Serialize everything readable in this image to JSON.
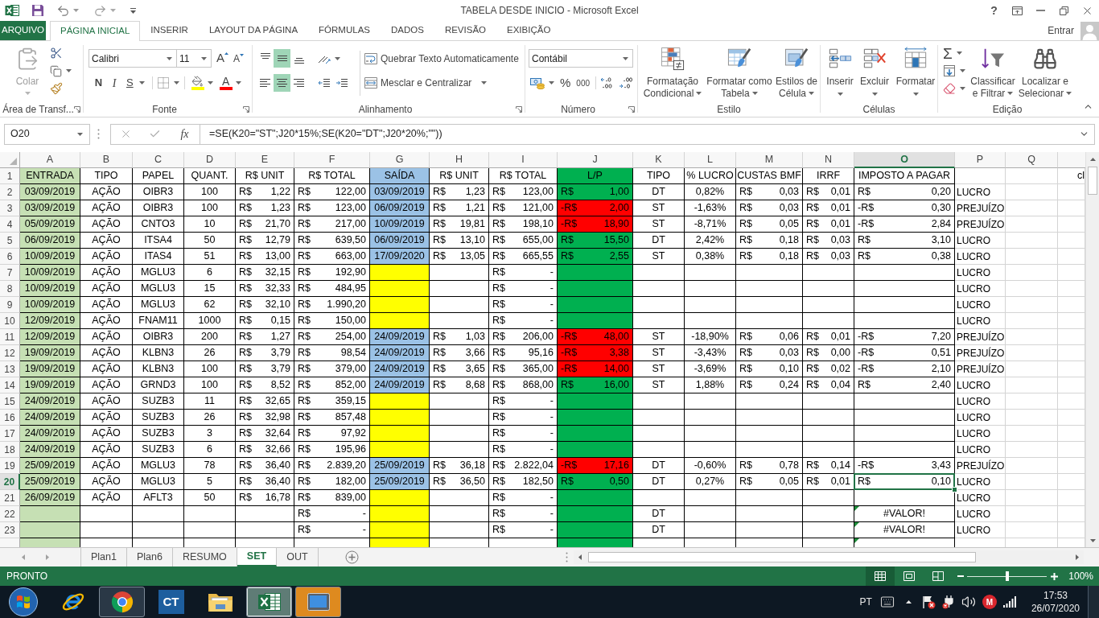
{
  "window": {
    "title": "TABELA DESDE INICIO - Microsoft Excel",
    "help": "?"
  },
  "ribbon_tabs": [
    {
      "label": "ARQUIVO",
      "kind": "file",
      "selected": false
    },
    {
      "label": "PÁGINA INICIAL",
      "kind": "tab",
      "selected": true
    },
    {
      "label": "INSERIR",
      "kind": "tab",
      "selected": false
    },
    {
      "label": "LAYOUT DA PÁGINA",
      "kind": "tab",
      "selected": false
    },
    {
      "label": "FÓRMULAS",
      "kind": "tab",
      "selected": false
    },
    {
      "label": "DADOS",
      "kind": "tab",
      "selected": false
    },
    {
      "label": "REVISÃO",
      "kind": "tab",
      "selected": false
    },
    {
      "label": "EXIBIÇÃO",
      "kind": "tab",
      "selected": false
    }
  ],
  "account": {
    "label": "Entrar"
  },
  "ribbon": {
    "clipboard": {
      "title": "Área de Transf...",
      "paste": {
        "label": "Colar",
        "disabled": true
      }
    },
    "font": {
      "title": "Fonte",
      "font_name": "Calibri",
      "font_size": "11",
      "grow": "A",
      "shrink": "A",
      "bold": "N",
      "italic": "I",
      "underline": "S",
      "fill": {
        "color": "#ffff00"
      },
      "font_color": {
        "label": "A",
        "color": "#ff0000"
      }
    },
    "alignment": {
      "title": "Alinhamento",
      "vertical": [
        {
          "kind": "top",
          "selected": false
        },
        {
          "kind": "middle",
          "selected": true
        },
        {
          "kind": "bottom",
          "selected": false
        }
      ],
      "horizontal": [
        {
          "kind": "left",
          "selected": false
        },
        {
          "kind": "center",
          "selected": true
        },
        {
          "kind": "right",
          "selected": false
        }
      ],
      "wrap_text": "Quebrar Texto Automaticamente",
      "merge": "Mesclar e Centralizar"
    },
    "number": {
      "title": "Número",
      "format": "Contábil",
      "percent": "%",
      "thousands": "000"
    },
    "styles": {
      "title": "Estilo",
      "buttons": [
        {
          "kind": "conditional",
          "label": "Formatação\nCondicional"
        },
        {
          "kind": "table",
          "label": "Formatar como\nTabela"
        },
        {
          "kind": "cell_styles",
          "label": "Estilos de\nCélula"
        }
      ]
    },
    "cells": {
      "title": "Células",
      "buttons": [
        {
          "kind": "insert",
          "label": "Inserir"
        },
        {
          "kind": "delete",
          "label": "Excluir"
        },
        {
          "kind": "format",
          "label": "Formatar"
        }
      ]
    },
    "editing": {
      "title": "Edição",
      "autosum": "Σ",
      "buttons": [
        {
          "kind": "sort_filter",
          "label": "Classificar\ne Filtrar"
        },
        {
          "kind": "find",
          "label": "Localizar e\nSelecionar"
        }
      ]
    }
  },
  "formula_bar": {
    "name_box": "O20",
    "function_label": "fx",
    "formula": "=SE(K20=\"ST\";J20*15%;SE(K20=\"DT\";J20*20%;\"\"))"
  },
  "grid": {
    "column_headers": [
      {
        "label": "A",
        "selected": false
      },
      {
        "label": "B",
        "selected": false
      },
      {
        "label": "C",
        "selected": false
      },
      {
        "label": "D",
        "selected": false
      },
      {
        "label": "E",
        "selected": false
      },
      {
        "label": "F",
        "selected": false
      },
      {
        "label": "G",
        "selected": false
      },
      {
        "label": "H",
        "selected": false
      },
      {
        "label": "I",
        "selected": false
      },
      {
        "label": "J",
        "selected": false
      },
      {
        "label": "K",
        "selected": false
      },
      {
        "label": "L",
        "selected": false
      },
      {
        "label": "M",
        "selected": false
      },
      {
        "label": "N",
        "selected": false
      },
      {
        "label": "O",
        "selected": true
      },
      {
        "label": "P",
        "selected": false
      },
      {
        "label": "Q",
        "selected": false
      }
    ],
    "rows": [
      {
        "number": "1",
        "selected": false,
        "cells": [
          {
            "text": "ENTRADA",
            "color": "#c6e0b4"
          },
          "TIPO",
          "PAPEL",
          "QUANT.",
          "R$ UNIT",
          "R$ TOTAL",
          {
            "text": "SAÍDA",
            "color": "#9bc2e6"
          },
          "R$ UNIT",
          "R$ TOTAL",
          {
            "text": "L/P",
            "color": "#00b050"
          },
          "TIPO",
          "% LUCRO",
          "CUSTAS BMF",
          "IRRF",
          "IMPOSTO A PAGAR",
          null,
          null,
          "cl"
        ]
      },
      {
        "number": "2",
        "selected": false,
        "cells": [
          {
            "text": "03/09/2019",
            "color": "#c6e0b4"
          },
          "AÇÃO",
          "OIBR3",
          "100",
          {
            "cur": "R$",
            "val": "1,22"
          },
          {
            "cur": "R$",
            "val": "122,00"
          },
          {
            "text": "03/09/2019",
            "color": "#9bc2e6"
          },
          {
            "cur": "R$",
            "val": "1,23"
          },
          {
            "cur": "R$",
            "val": "123,00"
          },
          {
            "cur": "R$",
            "val": "1,00",
            "color": "#00b050"
          },
          "DT",
          "0,82%",
          {
            "cur": "R$",
            "val": "0,03"
          },
          {
            "cur": "R$",
            "val": "0,01"
          },
          {
            "cur": "R$",
            "val": "0,20"
          },
          "LUCRO",
          null,
          null
        ]
      },
      {
        "number": "3",
        "selected": false,
        "cells": [
          {
            "text": "03/09/2019",
            "color": "#c6e0b4"
          },
          "AÇÃO",
          "OIBR3",
          "100",
          {
            "cur": "R$",
            "val": "1,23"
          },
          {
            "cur": "R$",
            "val": "123,00"
          },
          {
            "text": "06/09/2019",
            "color": "#9bc2e6"
          },
          {
            "cur": "R$",
            "val": "1,21"
          },
          {
            "cur": "R$",
            "val": "121,00"
          },
          {
            "cur": "-R$",
            "val": "2,00",
            "color": "#ff0000"
          },
          "ST",
          "-1,63%",
          {
            "cur": "R$",
            "val": "0,03"
          },
          {
            "cur": "R$",
            "val": "0,01"
          },
          {
            "cur": "-R$",
            "val": "0,30"
          },
          "PREJUÍZO",
          null,
          null
        ]
      },
      {
        "number": "4",
        "selected": false,
        "cells": [
          {
            "text": "05/09/2019",
            "color": "#c6e0b4"
          },
          "AÇÃO",
          "CNTO3",
          "10",
          {
            "cur": "R$",
            "val": "21,70"
          },
          {
            "cur": "R$",
            "val": "217,00"
          },
          {
            "text": "10/09/2019",
            "color": "#9bc2e6"
          },
          {
            "cur": "R$",
            "val": "19,81"
          },
          {
            "cur": "R$",
            "val": "198,10"
          },
          {
            "cur": "-R$",
            "val": "18,90",
            "color": "#ff0000"
          },
          "ST",
          "-8,71%",
          {
            "cur": "R$",
            "val": "0,05"
          },
          {
            "cur": "R$",
            "val": "0,01"
          },
          {
            "cur": "-R$",
            "val": "2,84"
          },
          "PREJUÍZO",
          null,
          null
        ]
      },
      {
        "number": "5",
        "selected": false,
        "cells": [
          {
            "text": "06/09/2019",
            "color": "#c6e0b4"
          },
          "AÇÃO",
          "ITSA4",
          "50",
          {
            "cur": "R$",
            "val": "12,79"
          },
          {
            "cur": "R$",
            "val": "639,50"
          },
          {
            "text": "06/09/2019",
            "color": "#9bc2e6"
          },
          {
            "cur": "R$",
            "val": "13,10"
          },
          {
            "cur": "R$",
            "val": "655,00"
          },
          {
            "cur": "R$",
            "val": "15,50",
            "color": "#00b050"
          },
          "DT",
          "2,42%",
          {
            "cur": "R$",
            "val": "0,18"
          },
          {
            "cur": "R$",
            "val": "0,03"
          },
          {
            "cur": "R$",
            "val": "3,10"
          },
          "LUCRO",
          null,
          null
        ]
      },
      {
        "number": "6",
        "selected": false,
        "cells": [
          {
            "text": "10/09/2019",
            "color": "#c6e0b4"
          },
          "AÇÃO",
          "ITAS4",
          "51",
          {
            "cur": "R$",
            "val": "13,00"
          },
          {
            "cur": "R$",
            "val": "663,00"
          },
          {
            "text": "17/09/2020",
            "color": "#9bc2e6"
          },
          {
            "cur": "R$",
            "val": "13,05"
          },
          {
            "cur": "R$",
            "val": "665,55"
          },
          {
            "cur": "R$",
            "val": "2,55",
            "color": "#00b050"
          },
          "ST",
          "0,38%",
          {
            "cur": "R$",
            "val": "0,18"
          },
          {
            "cur": "R$",
            "val": "0,03"
          },
          {
            "cur": "R$",
            "val": "0,38"
          },
          "LUCRO",
          null,
          null
        ]
      },
      {
        "number": "7",
        "selected": false,
        "cells": [
          {
            "text": "10/09/2019",
            "color": "#c6e0b4"
          },
          "AÇÃO",
          "MGLU3",
          "6",
          {
            "cur": "R$",
            "val": "32,15"
          },
          {
            "cur": "R$",
            "val": "192,90"
          },
          {
            "color": "#ffff00"
          },
          null,
          {
            "cur": "R$",
            "val": "-"
          },
          {
            "color": "#00b050"
          },
          null,
          null,
          null,
          null,
          null,
          "LUCRO",
          null,
          null
        ]
      },
      {
        "number": "8",
        "selected": false,
        "cells": [
          {
            "text": "10/09/2019",
            "color": "#c6e0b4"
          },
          "AÇÃO",
          "MGLU3",
          "15",
          {
            "cur": "R$",
            "val": "32,33"
          },
          {
            "cur": "R$",
            "val": "484,95"
          },
          {
            "color": "#ffff00"
          },
          null,
          {
            "cur": "R$",
            "val": "-"
          },
          {
            "color": "#00b050"
          },
          null,
          null,
          null,
          null,
          null,
          "LUCRO",
          null,
          null
        ]
      },
      {
        "number": "9",
        "selected": false,
        "cells": [
          {
            "text": "10/09/2019",
            "color": "#c6e0b4"
          },
          "AÇÃO",
          "MGLU3",
          "62",
          {
            "cur": "R$",
            "val": "32,10"
          },
          {
            "cur": "R$",
            "val": "1.990,20"
          },
          {
            "color": "#ffff00"
          },
          null,
          {
            "cur": "R$",
            "val": "-"
          },
          {
            "color": "#00b050"
          },
          null,
          null,
          null,
          null,
          null,
          "LUCRO",
          null,
          null
        ]
      },
      {
        "number": "10",
        "selected": false,
        "cells": [
          {
            "text": "12/09/2019",
            "color": "#c6e0b4"
          },
          "AÇÃO",
          "FNAM11",
          "1000",
          {
            "cur": "R$",
            "val": "0,15"
          },
          {
            "cur": "R$",
            "val": "150,00"
          },
          {
            "color": "#ffff00"
          },
          null,
          {
            "cur": "R$",
            "val": "-"
          },
          {
            "color": "#00b050"
          },
          null,
          null,
          null,
          null,
          null,
          "LUCRO",
          null,
          null
        ]
      },
      {
        "number": "11",
        "selected": false,
        "cells": [
          {
            "text": "12/09/2019",
            "color": "#c6e0b4"
          },
          "AÇÃO",
          "OIBR3",
          "200",
          {
            "cur": "R$",
            "val": "1,27"
          },
          {
            "cur": "R$",
            "val": "254,00"
          },
          {
            "text": "24/09/2019",
            "color": "#9bc2e6"
          },
          {
            "cur": "R$",
            "val": "1,03"
          },
          {
            "cur": "R$",
            "val": "206,00"
          },
          {
            "cur": "-R$",
            "val": "48,00",
            "color": "#ff0000"
          },
          "ST",
          "-18,90%",
          {
            "cur": "R$",
            "val": "0,06"
          },
          {
            "cur": "R$",
            "val": "0,01"
          },
          {
            "cur": "-R$",
            "val": "7,20"
          },
          "PREJUÍZO",
          null,
          null
        ]
      },
      {
        "number": "12",
        "selected": false,
        "cells": [
          {
            "text": "19/09/2019",
            "color": "#c6e0b4"
          },
          "AÇÃO",
          "KLBN3",
          "26",
          {
            "cur": "R$",
            "val": "3,79"
          },
          {
            "cur": "R$",
            "val": "98,54"
          },
          {
            "text": "24/09/2019",
            "color": "#9bc2e6"
          },
          {
            "cur": "R$",
            "val": "3,66"
          },
          {
            "cur": "R$",
            "val": "95,16"
          },
          {
            "cur": "-R$",
            "val": "3,38",
            "color": "#ff0000"
          },
          "ST",
          "-3,43%",
          {
            "cur": "R$",
            "val": "0,03"
          },
          {
            "cur": "R$",
            "val": "0,00"
          },
          {
            "cur": "-R$",
            "val": "0,51"
          },
          "PREJUÍZO",
          null,
          null
        ]
      },
      {
        "number": "13",
        "selected": false,
        "cells": [
          {
            "text": "19/09/2019",
            "color": "#c6e0b4"
          },
          "AÇÃO",
          "KLBN3",
          "100",
          {
            "cur": "R$",
            "val": "3,79"
          },
          {
            "cur": "R$",
            "val": "379,00"
          },
          {
            "text": "24/09/2019",
            "color": "#9bc2e6"
          },
          {
            "cur": "R$",
            "val": "3,65"
          },
          {
            "cur": "R$",
            "val": "365,00"
          },
          {
            "cur": "-R$",
            "val": "14,00",
            "color": "#ff0000"
          },
          "ST",
          "-3,69%",
          {
            "cur": "R$",
            "val": "0,10"
          },
          {
            "cur": "R$",
            "val": "0,02"
          },
          {
            "cur": "-R$",
            "val": "2,10"
          },
          "PREJUÍZO",
          null,
          null
        ]
      },
      {
        "number": "14",
        "selected": false,
        "cells": [
          {
            "text": "19/09/2019",
            "color": "#c6e0b4"
          },
          "AÇÃO",
          "GRND3",
          "100",
          {
            "cur": "R$",
            "val": "8,52"
          },
          {
            "cur": "R$",
            "val": "852,00"
          },
          {
            "text": "24/09/2019",
            "color": "#9bc2e6"
          },
          {
            "cur": "R$",
            "val": "8,68"
          },
          {
            "cur": "R$",
            "val": "868,00"
          },
          {
            "cur": "R$",
            "val": "16,00",
            "color": "#00b050"
          },
          "ST",
          "1,88%",
          {
            "cur": "R$",
            "val": "0,24"
          },
          {
            "cur": "R$",
            "val": "0,04"
          },
          {
            "cur": "R$",
            "val": "2,40"
          },
          "LUCRO",
          null,
          null
        ]
      },
      {
        "number": "15",
        "selected": false,
        "cells": [
          {
            "text": "24/09/2019",
            "color": "#c6e0b4"
          },
          "AÇÃO",
          "SUZB3",
          "11",
          {
            "cur": "R$",
            "val": "32,65"
          },
          {
            "cur": "R$",
            "val": "359,15"
          },
          {
            "color": "#ffff00"
          },
          null,
          {
            "cur": "R$",
            "val": "-"
          },
          {
            "color": "#00b050"
          },
          null,
          null,
          null,
          null,
          null,
          "LUCRO",
          null,
          null
        ]
      },
      {
        "number": "16",
        "selected": false,
        "cells": [
          {
            "text": "24/09/2019",
            "color": "#c6e0b4"
          },
          "AÇÃO",
          "SUZB3",
          "26",
          {
            "cur": "R$",
            "val": "32,98"
          },
          {
            "cur": "R$",
            "val": "857,48"
          },
          {
            "color": "#ffff00"
          },
          null,
          {
            "cur": "R$",
            "val": "-"
          },
          {
            "color": "#00b050"
          },
          null,
          null,
          null,
          null,
          null,
          "LUCRO",
          null,
          null
        ]
      },
      {
        "number": "17",
        "selected": false,
        "cells": [
          {
            "text": "24/09/2019",
            "color": "#c6e0b4"
          },
          "AÇÃO",
          "SUZB3",
          "3",
          {
            "cur": "R$",
            "val": "32,64"
          },
          {
            "cur": "R$",
            "val": "97,92"
          },
          {
            "color": "#ffff00"
          },
          null,
          {
            "cur": "R$",
            "val": "-"
          },
          {
            "color": "#00b050"
          },
          null,
          null,
          null,
          null,
          null,
          "LUCRO",
          null,
          null
        ]
      },
      {
        "number": "18",
        "selected": false,
        "cells": [
          {
            "text": "24/09/2019",
            "color": "#c6e0b4"
          },
          "AÇÃO",
          "SUZB3",
          "6",
          {
            "cur": "R$",
            "val": "32,66"
          },
          {
            "cur": "R$",
            "val": "195,96"
          },
          {
            "color": "#ffff00"
          },
          null,
          {
            "cur": "R$",
            "val": "-"
          },
          {
            "color": "#00b050"
          },
          null,
          null,
          null,
          null,
          null,
          "LUCRO",
          null,
          null
        ]
      },
      {
        "number": "19",
        "selected": false,
        "cells": [
          {
            "text": "25/09/2019",
            "color": "#c6e0b4"
          },
          "AÇÃO",
          "MGLU3",
          "78",
          {
            "cur": "R$",
            "val": "36,40"
          },
          {
            "cur": "R$",
            "val": "2.839,20"
          },
          {
            "text": "25/09/2019",
            "color": "#9bc2e6"
          },
          {
            "cur": "R$",
            "val": "36,18"
          },
          {
            "cur": "R$",
            "val": "2.822,04"
          },
          {
            "cur": "-R$",
            "val": "17,16",
            "color": "#ff0000"
          },
          "DT",
          "-0,60%",
          {
            "cur": "R$",
            "val": "0,78"
          },
          {
            "cur": "R$",
            "val": "0,14"
          },
          {
            "cur": "-R$",
            "val": "3,43"
          },
          "PREJUÍZO",
          null,
          null
        ]
      },
      {
        "number": "20",
        "selected": true,
        "cells": [
          {
            "text": "25/09/2019",
            "color": "#c6e0b4"
          },
          "AÇÃO",
          "MGLU3",
          "5",
          {
            "cur": "R$",
            "val": "36,40"
          },
          {
            "cur": "R$",
            "val": "182,00"
          },
          {
            "text": "25/09/2019",
            "color": "#9bc2e6"
          },
          {
            "cur": "R$",
            "val": "36,50"
          },
          {
            "cur": "R$",
            "val": "182,50"
          },
          {
            "cur": "R$",
            "val": "0,50",
            "color": "#00b050"
          },
          "DT",
          "0,27%",
          {
            "cur": "R$",
            "val": "0,05"
          },
          {
            "cur": "R$",
            "val": "0,01"
          },
          {
            "cur": "R$",
            "val": "0,10"
          },
          "LUCRO",
          null,
          null
        ]
      },
      {
        "number": "21",
        "selected": false,
        "cells": [
          {
            "text": "26/09/2019",
            "color": "#c6e0b4"
          },
          "AÇÃO",
          "AFLT3",
          "50",
          {
            "cur": "R$",
            "val": "16,78"
          },
          {
            "cur": "R$",
            "val": "839,00"
          },
          {
            "color": "#ffff00"
          },
          null,
          {
            "cur": "R$",
            "val": "-"
          },
          {
            "color": "#00b050"
          },
          null,
          null,
          null,
          null,
          null,
          "LUCRO",
          null,
          null
        ]
      },
      {
        "number": "22",
        "selected": false,
        "cells": [
          {
            "color": "#c6e0b4"
          },
          null,
          null,
          null,
          null,
          {
            "cur": "R$",
            "val": "-"
          },
          {
            "color": "#ffff00"
          },
          null,
          {
            "cur": "R$",
            "val": "-"
          },
          {
            "color": "#00b050"
          },
          "DT",
          null,
          null,
          null,
          {
            "text": "#VALOR!",
            "flag": true
          },
          "LUCRO",
          null,
          null
        ]
      },
      {
        "number": "23",
        "selected": false,
        "cells": [
          {
            "color": "#c6e0b4"
          },
          null,
          null,
          null,
          null,
          {
            "cur": "R$",
            "val": "-"
          },
          {
            "color": "#ffff00"
          },
          null,
          {
            "cur": "R$",
            "val": "-"
          },
          {
            "color": "#00b050"
          },
          "DT",
          null,
          null,
          null,
          {
            "text": "#VALOR!",
            "flag": true
          },
          "LUCRO",
          null,
          null
        ]
      },
      {
        "selected": false,
        "cut_off": true,
        "cells": [
          {
            "color": "#c6e0b4"
          },
          null,
          null,
          null,
          null,
          null,
          {
            "color": "#ffff00"
          },
          null,
          null,
          {
            "color": "#00b050"
          },
          null,
          null,
          null,
          null,
          {
            "flag": true
          },
          null,
          null,
          null
        ]
      }
    ]
  },
  "sheet_tabs": [
    {
      "label": "Plan1",
      "selected": false
    },
    {
      "label": "Plan6",
      "selected": false
    },
    {
      "label": "RESUMO",
      "selected": false
    },
    {
      "label": "SET",
      "selected": true
    },
    {
      "label": "OUT",
      "selected": false
    }
  ],
  "status_bar": {
    "text": "PRONTO",
    "views": [
      {
        "kind": "normal",
        "selected": true
      },
      {
        "kind": "page_layout",
        "selected": false
      },
      {
        "kind": "page_break",
        "selected": false
      }
    ],
    "zoom": {
      "level": 0.5,
      "label": "100%"
    }
  },
  "taskbar": {
    "apps": [
      {
        "kind": "ie",
        "running": false,
        "selected": false,
        "flashing": false
      },
      {
        "kind": "chrome",
        "running": true,
        "selected": false,
        "flashing": false
      },
      {
        "kind": "ct",
        "label": "CT",
        "running": false,
        "selected": false,
        "flashing": false
      },
      {
        "kind": "explorer",
        "running": false,
        "selected": false,
        "flashing": false
      },
      {
        "kind": "excel",
        "running": true,
        "selected": true,
        "flashing": false
      },
      {
        "kind": "tablet",
        "running": true,
        "selected": false,
        "flashing": true
      }
    ],
    "language": "PT",
    "tray_badge": "M",
    "time": "17:53",
    "date": "26/07/2020"
  }
}
